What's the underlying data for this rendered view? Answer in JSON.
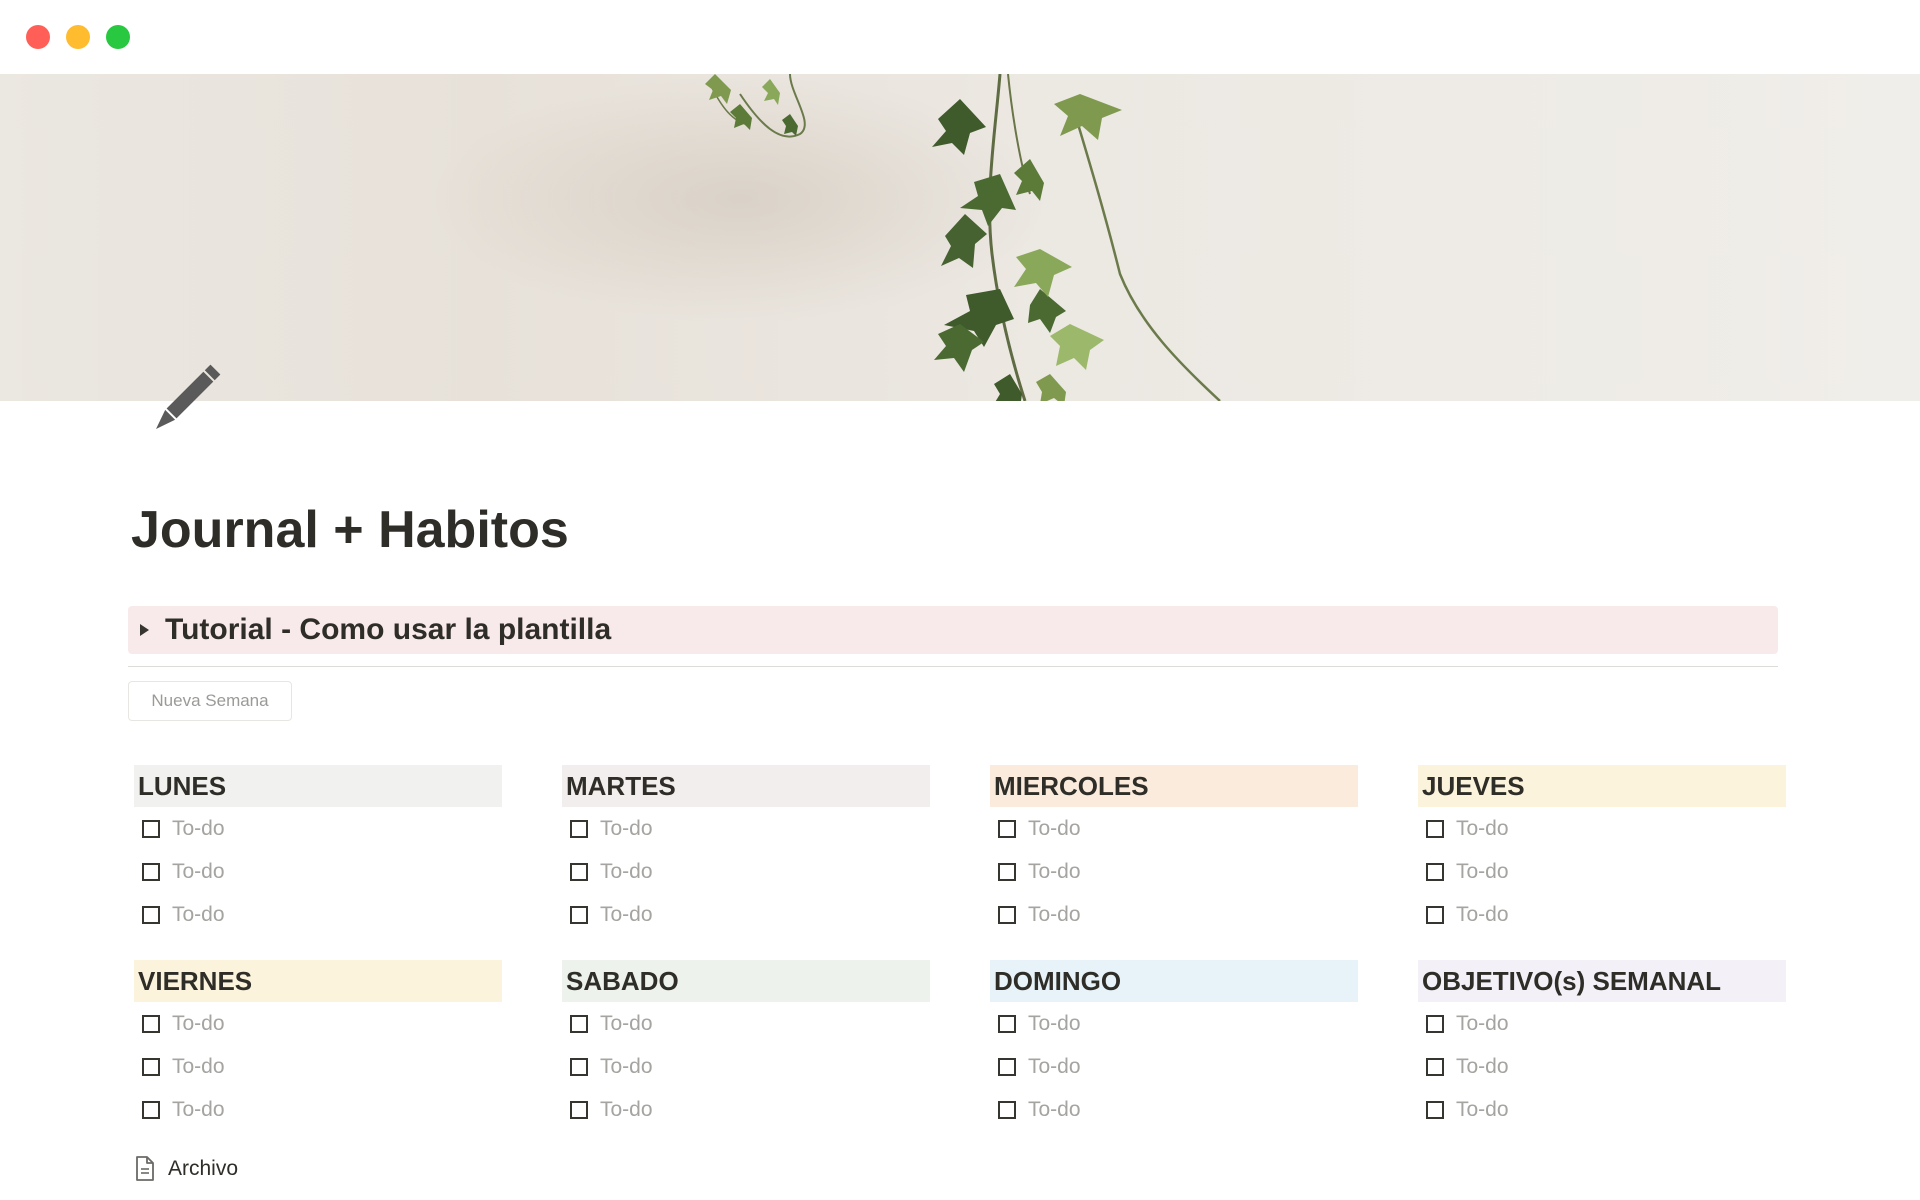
{
  "window": {
    "controls": [
      "close",
      "minimize",
      "maximize"
    ]
  },
  "page": {
    "icon": "pencil-icon",
    "title": "Journal + Habitos"
  },
  "toggle": {
    "label": "Tutorial - Como usar la plantilla",
    "expanded": false
  },
  "new_week_button": {
    "label": "Nueva Semana"
  },
  "columns": [
    {
      "title": "LUNES",
      "color": "#f1f1ef",
      "todos": [
        "To-do",
        "To-do",
        "To-do"
      ]
    },
    {
      "title": "MARTES",
      "color": "#f3eeee",
      "todos": [
        "To-do",
        "To-do",
        "To-do"
      ]
    },
    {
      "title": "MIERCOLES",
      "color": "#faebdd",
      "todos": [
        "To-do",
        "To-do",
        "To-do"
      ]
    },
    {
      "title": "JUEVES",
      "color": "#fbf3db",
      "todos": [
        "To-do",
        "To-do",
        "To-do"
      ]
    },
    {
      "title": "VIERNES",
      "color": "#fbf3db",
      "todos": [
        "To-do",
        "To-do",
        "To-do"
      ]
    },
    {
      "title": "SABADO",
      "color": "#edf3ec",
      "todos": [
        "To-do",
        "To-do",
        "To-do"
      ]
    },
    {
      "title": "DOMINGO",
      "color": "#e7f3f8",
      "todos": [
        "To-do",
        "To-do",
        "To-do"
      ]
    },
    {
      "title": "OBJETIVO(s) SEMANAL",
      "color": "#f4f0f7",
      "todos": [
        "To-do",
        "To-do",
        "To-do"
      ]
    }
  ],
  "archive_link": {
    "icon": "page-icon",
    "label": "Archivo"
  }
}
